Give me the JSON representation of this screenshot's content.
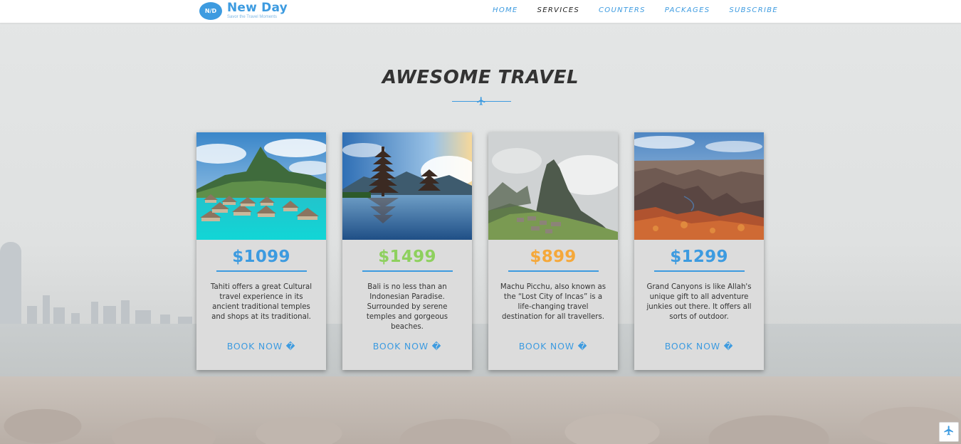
{
  "brand": {
    "badge": "N/D",
    "name": "New Day",
    "tagline": "Savor the Travel Moments",
    "accent": "#3d9be0"
  },
  "nav": {
    "items": [
      {
        "label": "HOME",
        "active": false
      },
      {
        "label": "SERVICES",
        "active": true
      },
      {
        "label": "COUNTERS",
        "active": false
      },
      {
        "label": "PACKAGES",
        "active": false
      },
      {
        "label": "SUBSCRIBE",
        "active": false
      }
    ]
  },
  "section": {
    "title": "AWESOME TRAVEL",
    "divider_icon": "airplane-icon"
  },
  "cards": [
    {
      "image": "tahiti-overwater-bungalows-image",
      "price": "$1099",
      "price_color": "#3d9be0",
      "description": "Tahiti offers a great Cultural travel experience in its ancient traditional temples and shops at its traditional.",
      "cta": "BOOK NOW �"
    },
    {
      "image": "bali-temple-lake-image",
      "price": "$1499",
      "price_color": "#8ed05e",
      "description": "Bali is no less than an Indonesian Paradise. Surrounded by serene temples and gorgeous beaches.",
      "cta": "BOOK NOW �"
    },
    {
      "image": "machu-picchu-image",
      "price": "$899",
      "price_color": "#f5a83a",
      "description": "Machu Picchu, also known as the “Lost City of Incas” is a life-changing travel destination for all travellers.",
      "cta": "BOOK NOW �"
    },
    {
      "image": "grand-canyon-image",
      "price": "$1299",
      "price_color": "#3d9be0",
      "description": "Grand Canyons is like Allah's unique gift to all adventure junkies out there. It offers all sorts of outdoor.",
      "cta": "BOOK NOW �"
    }
  ],
  "floating_button": {
    "icon": "airplane-icon"
  }
}
